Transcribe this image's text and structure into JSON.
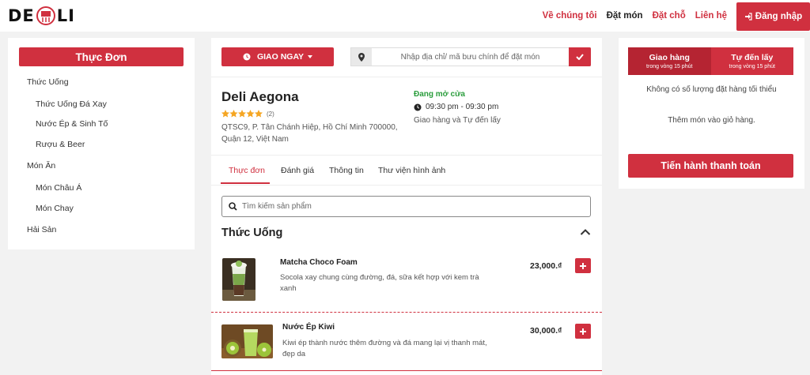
{
  "brand": {
    "logo_left": "DE",
    "logo_right": "LI",
    "accent": "#d0303f"
  },
  "nav": {
    "items": [
      {
        "label": "Về chúng tôi",
        "active": false
      },
      {
        "label": "Đặt món",
        "active": true
      },
      {
        "label": "Đặt chỗ",
        "active": false
      },
      {
        "label": "Liên hệ",
        "active": false
      }
    ],
    "login_label": "Đăng nhập"
  },
  "sidebar": {
    "title": "Thực Đơn",
    "categories": [
      {
        "label": "Thức Uống",
        "level": 1
      },
      {
        "label": "Thức Uống Đá Xay",
        "level": 2
      },
      {
        "label": "Nước Ép & Sinh Tố",
        "level": 2
      },
      {
        "label": "Rượu & Beer",
        "level": 2
      },
      {
        "label": "Món Ăn",
        "level": 1
      },
      {
        "label": "Món Châu Á",
        "level": 2
      },
      {
        "label": "Món Chay",
        "level": 2
      },
      {
        "label": "Hải Sản",
        "level": 1
      }
    ]
  },
  "order_bar": {
    "delivery_label": "GIAO NGAY",
    "address_placeholder": "Nhập địa chỉ/ mã bưu chính để đặt món"
  },
  "restaurant": {
    "name": "Deli Aegona",
    "rating": 5,
    "review_count": "(2)",
    "address": "QTSC9, P. Tân Chánh Hiệp, Hồ Chí Minh 700000, Quận 12, Việt Nam",
    "status": "Đang mở cửa",
    "hours": "09:30 pm - 09:30 pm",
    "service_modes": "Giao hàng và Tự đến lấy"
  },
  "tabs": [
    {
      "label": "Thực đơn",
      "active": true
    },
    {
      "label": "Đánh giá",
      "active": false
    },
    {
      "label": "Thông tin",
      "active": false
    },
    {
      "label": "Thư viện hình ảnh",
      "active": false
    }
  ],
  "search": {
    "placeholder": "Tìm kiếm sản phẩm"
  },
  "section": {
    "title": "Thức Uống"
  },
  "products": [
    {
      "name": "Matcha Choco Foam",
      "description": "Socola xay chung cùng đường, đá, sữa kết hợp với kem trà xanh",
      "price": "23,000.₫",
      "image": "matcha-drink-image"
    },
    {
      "name": "Nước Ép Kiwi",
      "description": "Kiwi ép thành nước thêm đường và đá mang lại vị thanh mát, đẹp da",
      "price": "30,000.₫",
      "image": "kiwi-juice-image"
    }
  ],
  "cart": {
    "modes": [
      {
        "label": "Giao hàng",
        "sub": "trong vòng 15 phút",
        "selected": true
      },
      {
        "label": "Tự đến lấy",
        "sub": "trong vòng 15 phút",
        "selected": false
      }
    ],
    "min_note": "Không có số lượng đặt hàng tối thiểu",
    "empty_note": "Thêm món vào giỏ hàng.",
    "checkout_label": "Tiến hành thanh toán"
  }
}
